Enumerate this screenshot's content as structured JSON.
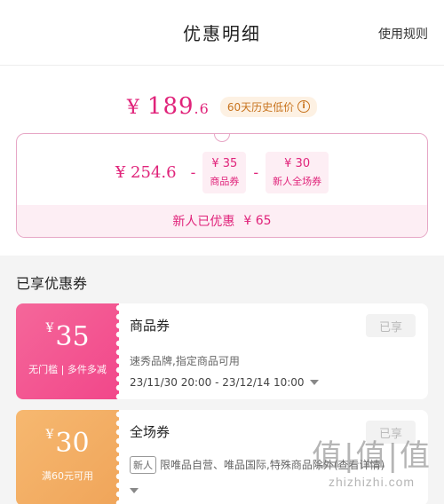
{
  "header": {
    "title": "优惠明细",
    "rules_link": "使用规则"
  },
  "summary": {
    "final_price_yen": "¥",
    "final_price_int": "189",
    "final_price_dec": ".6",
    "history_badge": "60天历史低价",
    "original_price": "¥ 254.6",
    "minus": "-",
    "chips": [
      {
        "amount": "¥ 35",
        "label": "商品券"
      },
      {
        "amount": "¥ 30",
        "label": "新人全场券"
      }
    ],
    "footer_label": "新人已优惠",
    "footer_amount": "¥ 65"
  },
  "section": {
    "title": "已享优惠券"
  },
  "coupons": [
    {
      "amount_symbol": "¥",
      "amount": "35",
      "condition": "无门槛 | 多件多减",
      "title": "商品券",
      "description": "速秀品牌,指定商品可用",
      "date": "23/11/30 20:00 - 23/12/14 10:00",
      "button": "已享"
    },
    {
      "amount_symbol": "¥",
      "amount": "30",
      "condition": "满60元可用",
      "title": "全场券",
      "tag": "新人",
      "description": "限唯品自营、唯品国际,特殊商品除外(查看详情)",
      "button": "已享"
    }
  ],
  "watermark": {
    "top": "值|值|值",
    "bottom": "zhizhizhi.com"
  },
  "colors": {
    "accent": "#e0237a",
    "badge_bg": "#fdf1e3",
    "badge_text": "#c8741f",
    "coupon_pink": "#f2478a",
    "coupon_orange": "#f0a55a"
  }
}
